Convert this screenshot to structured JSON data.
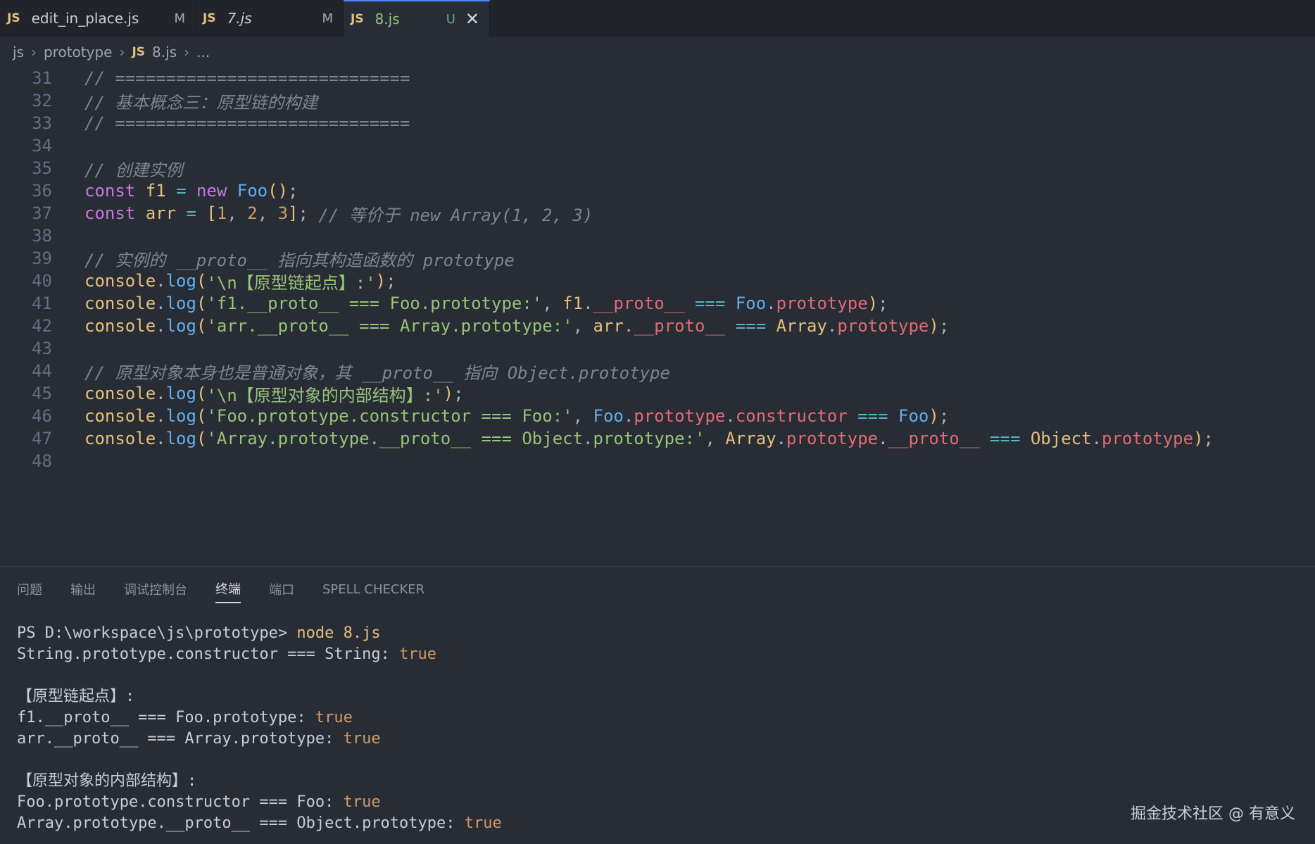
{
  "tabs": [
    {
      "badge": "JS",
      "name": "edit_in_place.js",
      "status": "M"
    },
    {
      "badge": "JS",
      "name": "7.js",
      "status": "M"
    },
    {
      "badge": "JS",
      "name": "8.js",
      "status": "U",
      "close": "✕"
    }
  ],
  "breadcrumb": {
    "seg1": "js",
    "seg2": "prototype",
    "badge": "JS",
    "file": "8.js",
    "more": "...",
    "sep": "›"
  },
  "editor": {
    "line_numbers": [
      "31",
      "32",
      "33",
      "34",
      "35",
      "36",
      "37",
      "38",
      "39",
      "40",
      "41",
      "42",
      "43",
      "44",
      "45",
      "46",
      "47",
      "48"
    ],
    "l31": "// =============================",
    "l32": "// 基本概念三：原型链的构建",
    "l33": "// =============================",
    "l35": "// 创建实例",
    "l37_comment": "// 等价于 new Array(1, 2, 3)",
    "l39": "// 实例的 __proto__ 指向其构造函数的 prototype",
    "l40_str": "'\\n【原型链起点】:'",
    "l41_str": "'f1.__proto__ === Foo.prototype:'",
    "l42_str": "'arr.__proto__ === Array.prototype:'",
    "l44": "// 原型对象本身也是普通对象，其 __proto__ 指向 Object.prototype",
    "l45_str": "'\\n【原型对象的内部结构】:'",
    "l46_str": "'Foo.prototype.constructor === Foo:'",
    "l47_str": "'Array.prototype.__proto__ === Object.prototype:'"
  },
  "panel": {
    "tabs": [
      "问题",
      "输出",
      "调试控制台",
      "终端",
      "端口",
      "SPELL CHECKER"
    ],
    "active_tab": "终端"
  },
  "terminal": {
    "prompt": "PS D:\\workspace\\js\\prototype> ",
    "command": "node 8.js",
    "lines": [
      {
        "text": "String.prototype.constructor === String: ",
        "value": "true"
      },
      {
        "text": "",
        "value": ""
      },
      {
        "text": "【原型链起点】:",
        "value": ""
      },
      {
        "text": "f1.__proto__ === Foo.prototype: ",
        "value": "true"
      },
      {
        "text": "arr.__proto__ === Array.prototype: ",
        "value": "true"
      },
      {
        "text": "",
        "value": ""
      },
      {
        "text": "【原型对象的内部结构】:",
        "value": ""
      },
      {
        "text": "Foo.prototype.constructor === Foo: ",
        "value": "true"
      },
      {
        "text": "Array.prototype.__proto__ === Object.prototype: ",
        "value": "true"
      }
    ]
  },
  "watermark": "掘金技术社区 @ 有意义",
  "colors": {
    "background": "#282c34",
    "keyword": "#c678dd",
    "string": "#98c379",
    "function": "#61afef",
    "property": "#e06c75",
    "variable": "#e5c07b",
    "number": "#d19a66",
    "comment": "#7f848e"
  }
}
